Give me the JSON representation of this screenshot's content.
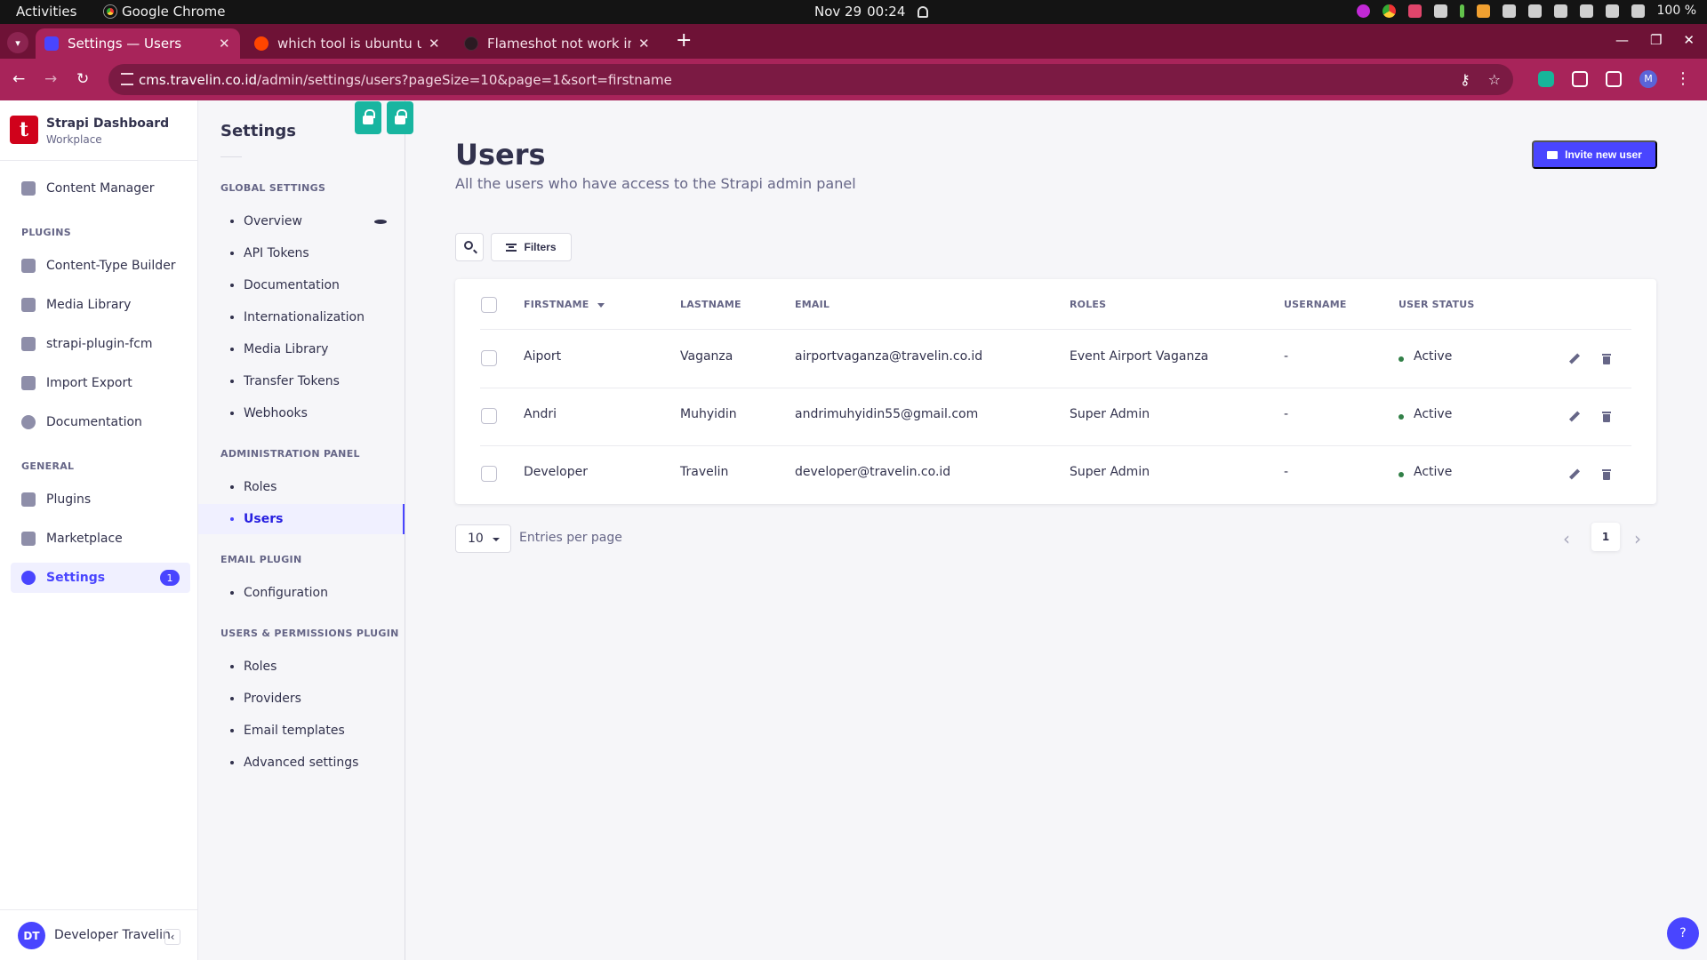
{
  "os": {
    "activities": "Activities",
    "app_name": "Google Chrome",
    "date": "Nov 29",
    "time": "00:24",
    "battery": "100 %"
  },
  "browser": {
    "tabs": [
      {
        "title": "Settings — Users",
        "favicon": "strapi-icon",
        "active": true
      },
      {
        "title": "which tool is ubuntu using",
        "favicon": "reddit-icon",
        "active": false
      },
      {
        "title": "Flameshot not work in ubuntu",
        "favicon": "github-icon",
        "active": false
      }
    ],
    "new_tab": "+",
    "url_host": "cms.travelin.co.id",
    "url_path": "/admin/settings/users?pageSize=10&page=1&sort=firstname",
    "profile_initial": "M"
  },
  "brand": {
    "logo_letter": "t",
    "title": "Strapi Dashboard",
    "subtitle": "Workplace"
  },
  "mainnav": {
    "content_manager": "Content Manager",
    "plugins_section": "PLUGINS",
    "plugins": [
      "Content-Type Builder",
      "Media Library",
      "strapi-plugin-fcm",
      "Import Export",
      "Documentation"
    ],
    "general_section": "GENERAL",
    "general": [
      "Plugins",
      "Marketplace",
      "Settings"
    ],
    "settings_badge": "1",
    "user_initials": "DT",
    "user_name": "Developer Travelin"
  },
  "subnav": {
    "title": "Settings",
    "global_section": "GLOBAL SETTINGS",
    "global_items": [
      "Overview",
      "API Tokens",
      "Documentation",
      "Internationalization",
      "Media Library",
      "Transfer Tokens",
      "Webhooks"
    ],
    "admin_section": "ADMINISTRATION PANEL",
    "admin_items": [
      "Roles",
      "Users"
    ],
    "email_section": "EMAIL PLUGIN",
    "email_items": [
      "Configuration"
    ],
    "up_section": "USERS & PERMISSIONS PLUGIN",
    "up_items": [
      "Roles",
      "Providers",
      "Email templates",
      "Advanced settings"
    ]
  },
  "page": {
    "title": "Users",
    "subtitle": "All the users who have access to the Strapi admin panel",
    "invite_label": "Invite new user",
    "filters_label": "Filters"
  },
  "table": {
    "headers": [
      "FIRSTNAME",
      "LASTNAME",
      "EMAIL",
      "ROLES",
      "USERNAME",
      "USER STATUS"
    ],
    "rows": [
      {
        "firstname": "Aiport",
        "lastname": "Vaganza",
        "email": "airportvaganza@travelin.co.id",
        "roles": "Event Airport Vaganza",
        "username": "-",
        "status": "Active"
      },
      {
        "firstname": "Andri",
        "lastname": "Muhyidin",
        "email": "andrimuhyidin55@gmail.com",
        "roles": "Super Admin",
        "username": "-",
        "status": "Active"
      },
      {
        "firstname": "Developer",
        "lastname": "Travelin",
        "email": "developer@travelin.co.id",
        "roles": "Super Admin",
        "username": "-",
        "status": "Active"
      }
    ]
  },
  "pagination": {
    "page_size": "10",
    "entries_label": "Entries per page",
    "current_page": "1"
  },
  "help": "?",
  "colors": {
    "accent": "#4945ff",
    "chrome_tabbar": "#6e1236",
    "chrome_toolbar": "#a8245a",
    "status_active": "#328048"
  }
}
